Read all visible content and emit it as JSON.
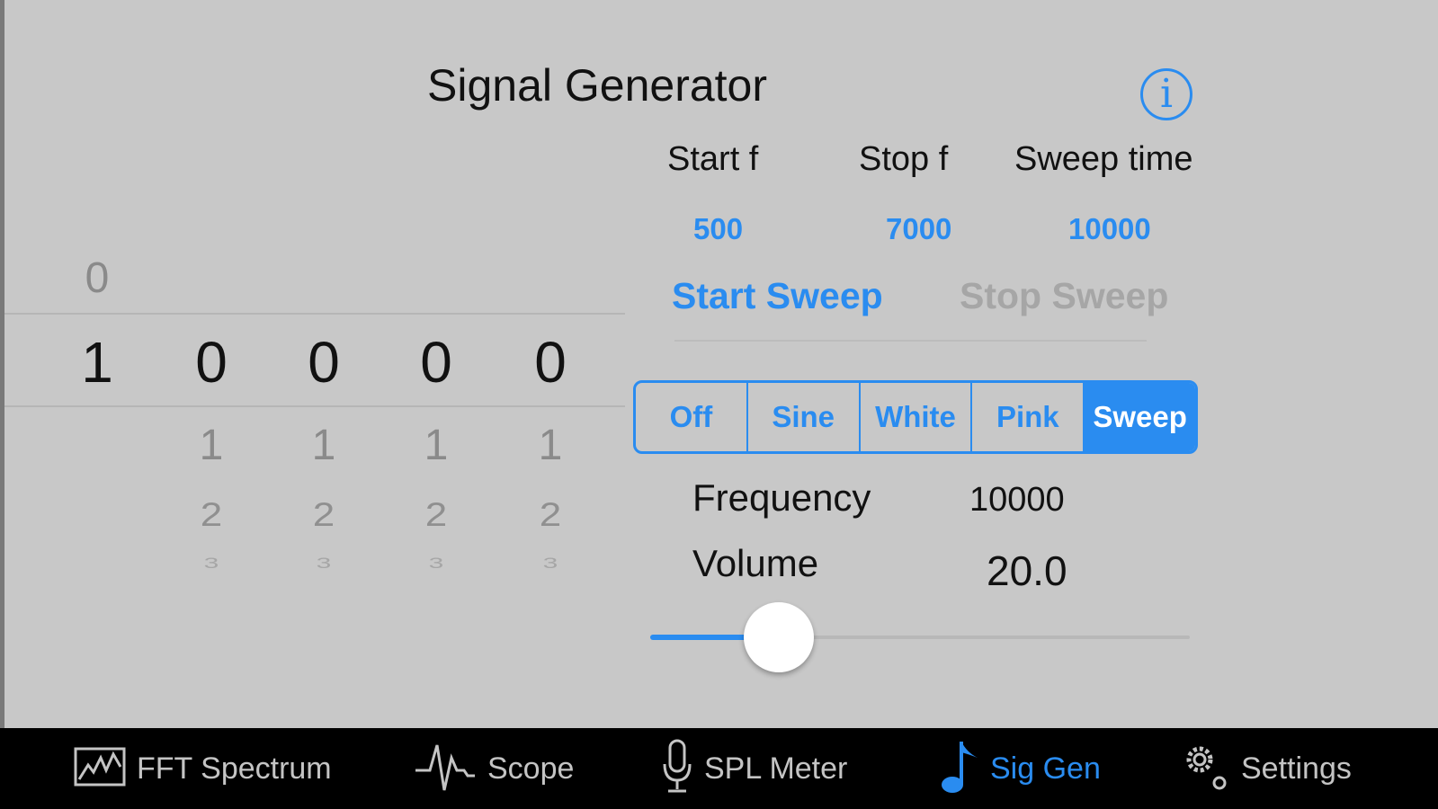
{
  "header": {
    "title": "Signal Generator",
    "info_icon": "info-icon"
  },
  "sweep": {
    "labels": [
      "Start f",
      "Stop f",
      "Sweep time"
    ],
    "values": [
      "500",
      "7000",
      "10000"
    ],
    "start_label": "Start Sweep",
    "stop_label": "Stop Sweep"
  },
  "picker": {
    "columns": [
      {
        "above": "0",
        "selected": "1",
        "below1": "",
        "below2": "",
        "below3": ""
      },
      {
        "above": "",
        "selected": "0",
        "below1": "1",
        "below2": "2",
        "below3": "3"
      },
      {
        "above": "",
        "selected": "0",
        "below1": "1",
        "below2": "2",
        "below3": "3"
      },
      {
        "above": "",
        "selected": "0",
        "below1": "1",
        "below2": "2",
        "below3": "3"
      },
      {
        "above": "",
        "selected": "0",
        "below1": "1",
        "below2": "2",
        "below3": "3"
      }
    ]
  },
  "mode": {
    "options": [
      "Off",
      "Sine",
      "White",
      "Pink",
      "Sweep"
    ],
    "selected": "Sweep"
  },
  "frequency": {
    "label": "Frequency",
    "value": "10000"
  },
  "volume": {
    "label": "Volume",
    "value": "20.0",
    "slider_fraction": 0.23
  },
  "tabs": [
    {
      "label": "FFT Spectrum",
      "icon": "spectrum-icon",
      "active": false
    },
    {
      "label": "Scope",
      "icon": "waveform-icon",
      "active": false
    },
    {
      "label": "SPL Meter",
      "icon": "microphone-icon",
      "active": false
    },
    {
      "label": "Sig Gen",
      "icon": "music-note-icon",
      "active": true
    },
    {
      "label": "Settings",
      "icon": "gear-icon",
      "active": false
    }
  ],
  "colors": {
    "accent": "#2a8cf0",
    "background": "#c8c8c8",
    "tabbar": "#000000"
  }
}
